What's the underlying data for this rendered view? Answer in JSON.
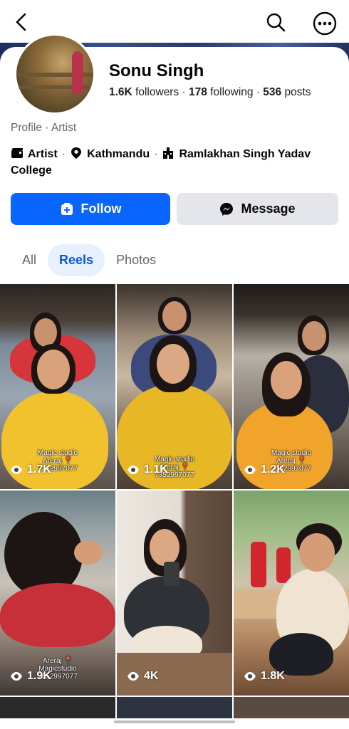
{
  "topbar": {
    "back_icon": "back-arrow-icon",
    "search_icon": "search-icon",
    "more_icon": "more-options-icon"
  },
  "profile": {
    "name": "Sonu Singh",
    "followers_count": "1.6K",
    "followers_label": "followers",
    "following_count": "178",
    "following_label": "following",
    "posts_count": "536",
    "posts_label": "posts",
    "category": "Profile · Artist",
    "details": {
      "occupation": "Artist",
      "location": "Kathmandu",
      "education": "Ramlakhan Singh Yadav College"
    }
  },
  "actions": {
    "follow_label": "Follow",
    "message_label": "Message"
  },
  "tabs": [
    {
      "label": "All",
      "active": false
    },
    {
      "label": "Reels",
      "active": true
    },
    {
      "label": "Photos",
      "active": false
    }
  ],
  "reels": [
    {
      "views": "1.7K",
      "caption_lines": [
        "Magic studio",
        "Areraj 📍",
        "7352997077"
      ]
    },
    {
      "views": "1.1K",
      "caption_lines": [
        "Magic studio",
        "Areraj 📍",
        "7352997077"
      ]
    },
    {
      "views": "1.2K",
      "caption_lines": [
        "Magic studio",
        "Areraj 📍",
        "7352997077"
      ]
    },
    {
      "views": "1.9K",
      "caption_lines": [
        "Areraj 📍",
        "Magicstudio",
        "7352997077"
      ]
    },
    {
      "views": "4K",
      "caption_lines": []
    },
    {
      "views": "1.8K",
      "caption_lines": []
    }
  ],
  "colors": {
    "primary": "#0866ff",
    "secondary_button": "#e4e6eb",
    "active_tab_bg": "#e7f0fd",
    "active_tab_text": "#0a59d8",
    "muted_text": "#65676b"
  }
}
